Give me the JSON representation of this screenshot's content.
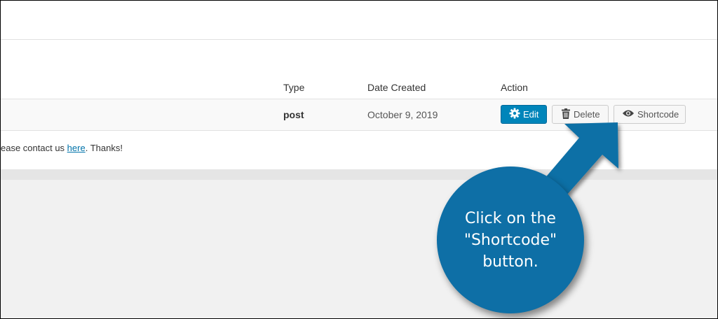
{
  "table": {
    "headers": {
      "type": "Type",
      "date_created": "Date Created",
      "action": "Action"
    },
    "rows": [
      {
        "type": "post",
        "date_created": "October 9, 2019"
      }
    ]
  },
  "actions": {
    "edit_label": "Edit",
    "delete_label": "Delete",
    "shortcode_label": "Shortcode"
  },
  "notice": {
    "text_before": "ease contact us ",
    "link_text": "here",
    "text_after": ". Thanks!"
  },
  "callout": {
    "lines": [
      "Click on the",
      "\"Shortcode\"",
      "button."
    ]
  },
  "colors": {
    "primary_button": "#0085ba",
    "callout": "#0e6fa6",
    "link": "#0073aa"
  },
  "icons": {
    "edit": "gear-icon",
    "delete": "trash-icon",
    "shortcode": "eye-icon"
  }
}
